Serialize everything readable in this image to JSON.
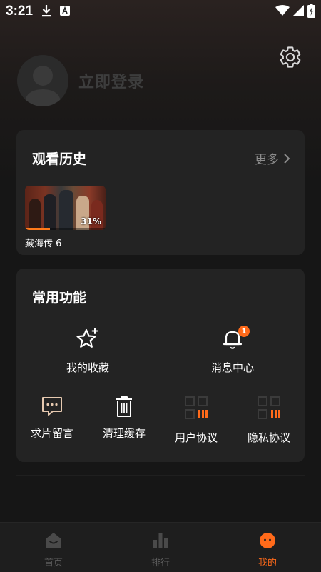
{
  "status_bar": {
    "time": "3:21",
    "icons": [
      "download-icon",
      "font-app-icon",
      "wifi-icon",
      "signal-icon",
      "battery-charging-icon"
    ]
  },
  "profile": {
    "login_label": "立即登录",
    "avatar_icon": "person-avatar-icon",
    "settings_icon": "gear-icon"
  },
  "history": {
    "title": "观看历史",
    "more_label": "更多",
    "items": [
      {
        "title": "藏海传 6",
        "progress_label": "31%",
        "progress": 0.31
      }
    ]
  },
  "functions": {
    "title": "常用功能",
    "items": [
      {
        "label": "我的收藏",
        "icon": "star-sparkle-icon"
      },
      {
        "label": "消息中心",
        "icon": "bell-icon",
        "badge": "1"
      },
      {
        "label": "求片留言",
        "icon": "chat-bubble-icon"
      },
      {
        "label": "清理缓存",
        "icon": "trash-icon"
      },
      {
        "label": "用户协议",
        "icon": "grid-bars-icon"
      },
      {
        "label": "隐私协议",
        "icon": "grid-bars-icon"
      }
    ]
  },
  "bottom_nav": {
    "items": [
      {
        "label": "首页",
        "icon": "home-icon",
        "active": false
      },
      {
        "label": "排行",
        "icon": "bar-chart-icon",
        "active": false
      },
      {
        "label": "我的",
        "icon": "smiley-face-icon",
        "active": true
      }
    ]
  },
  "colors": {
    "accent": "#ff6a1a",
    "card": "#232323",
    "background": "#161616",
    "muted_text": "#8c8c8c",
    "inactive_nav": "#5e5e5e"
  }
}
